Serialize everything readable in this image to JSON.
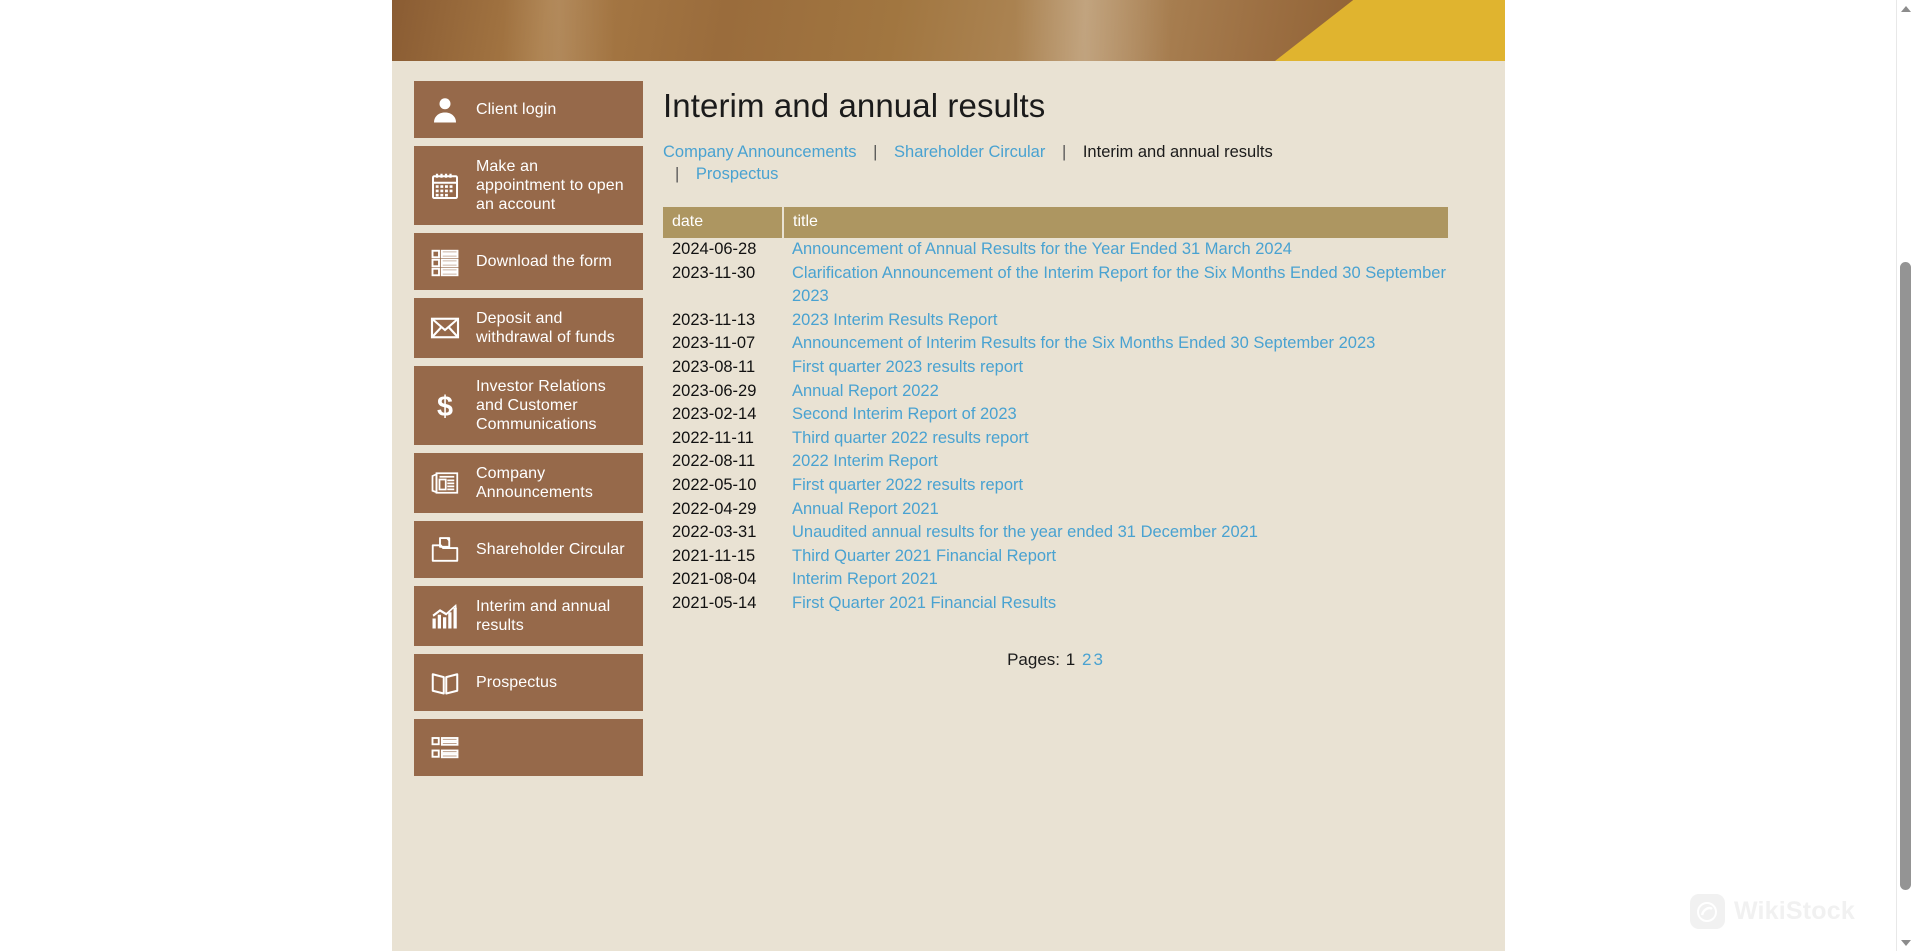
{
  "theme": {
    "page_background": "#ffffff",
    "content_background": "#e9e2d3",
    "nav_item_background": "#96694a",
    "table_header_background": "#ad9661",
    "link_color": "#49a2d1",
    "banner_accent": "#e0b42f"
  },
  "sidebar": {
    "items": [
      {
        "label": "Client login",
        "icon": "user-icon"
      },
      {
        "label": "Make an appointment to open an account",
        "icon": "calendar-icon"
      },
      {
        "label": "Download the form",
        "icon": "form-list-icon"
      },
      {
        "label": "Deposit and withdrawal of funds",
        "icon": "envelope-icon"
      },
      {
        "label": "Investor Relations and Customer Communications",
        "icon": "dollar-icon"
      },
      {
        "label": "Company Announcements",
        "icon": "newspaper-icon"
      },
      {
        "label": "Shareholder Circular",
        "icon": "folder-document-icon"
      },
      {
        "label": "Interim and annual results",
        "icon": "bar-chart-icon"
      },
      {
        "label": "Prospectus",
        "icon": "open-book-icon"
      },
      {
        "label": "",
        "icon": "list-icon"
      }
    ]
  },
  "main": {
    "title": "Interim and annual results",
    "breadcrumb": {
      "links": [
        {
          "label": "Company Announcements",
          "is_current": false
        },
        {
          "label": "Shareholder Circular",
          "is_current": false
        },
        {
          "label": "Interim and annual results",
          "is_current": true
        },
        {
          "label": "Prospectus",
          "is_current": false
        }
      ],
      "separator": "|"
    },
    "table": {
      "columns": [
        "date",
        "title"
      ],
      "rows": [
        {
          "date": "2024-06-28",
          "title": "Announcement of Annual Results for the Year Ended 31 March 2024"
        },
        {
          "date": "2023-11-30",
          "title": "Clarification Announcement of the Interim Report for the Six Months Ended 30 September 2023"
        },
        {
          "date": "2023-11-13",
          "title": "2023 Interim Results Report"
        },
        {
          "date": "2023-11-07",
          "title": "Announcement of Interim Results for the Six Months Ended 30 September 2023"
        },
        {
          "date": "2023-08-11",
          "title": "First quarter 2023 results report"
        },
        {
          "date": "2023-06-29",
          "title": "Annual Report 2022"
        },
        {
          "date": "2023-02-14",
          "title": "Second Interim Report of 2023"
        },
        {
          "date": "2022-11-11",
          "title": "Third quarter 2022 results report"
        },
        {
          "date": "2022-08-11",
          "title": "2022 Interim Report"
        },
        {
          "date": "2022-05-10",
          "title": "First quarter 2022 results report"
        },
        {
          "date": "2022-04-29",
          "title": "Annual Report 2021"
        },
        {
          "date": "2022-03-31",
          "title": "Unaudited annual results for the year ended 31 December 2021"
        },
        {
          "date": "2021-11-15",
          "title": "Third Quarter 2021 Financial Report"
        },
        {
          "date": "2021-08-04",
          "title": "Interim Report 2021"
        },
        {
          "date": "2021-05-14",
          "title": "First Quarter 2021 Financial Results"
        }
      ]
    },
    "pager": {
      "label": "Pages:",
      "pages": [
        {
          "number": "1",
          "is_current": true
        },
        {
          "number": "2",
          "is_current": false
        },
        {
          "number": "3",
          "is_current": false
        }
      ]
    }
  },
  "watermark": {
    "text": "WikiStock"
  }
}
